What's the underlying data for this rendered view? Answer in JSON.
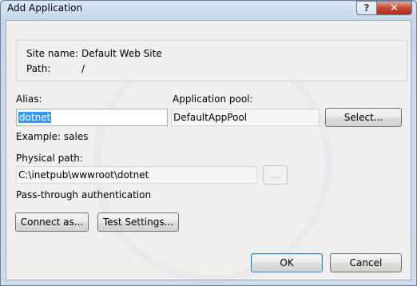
{
  "window": {
    "title": "Add Application",
    "help_label": "?",
    "close_label": "✕"
  },
  "site": {
    "name_label": "Site name:",
    "name_value": "Default Web Site",
    "path_label": "Path:",
    "path_value": "/"
  },
  "alias": {
    "label": "Alias:",
    "value": "dotnet",
    "example": "Example: sales"
  },
  "app_pool": {
    "label": "Application pool:",
    "value": "DefaultAppPool",
    "select_label": "Select..."
  },
  "physical_path": {
    "label": "Physical path:",
    "value": "C:\\inetpub\\wwwroot\\dotnet",
    "browse_label": "..."
  },
  "auth": {
    "label": "Pass-through authentication",
    "connect_as_label": "Connect as...",
    "test_settings_label": "Test Settings..."
  },
  "footer": {
    "ok_label": "OK",
    "cancel_label": "Cancel"
  }
}
